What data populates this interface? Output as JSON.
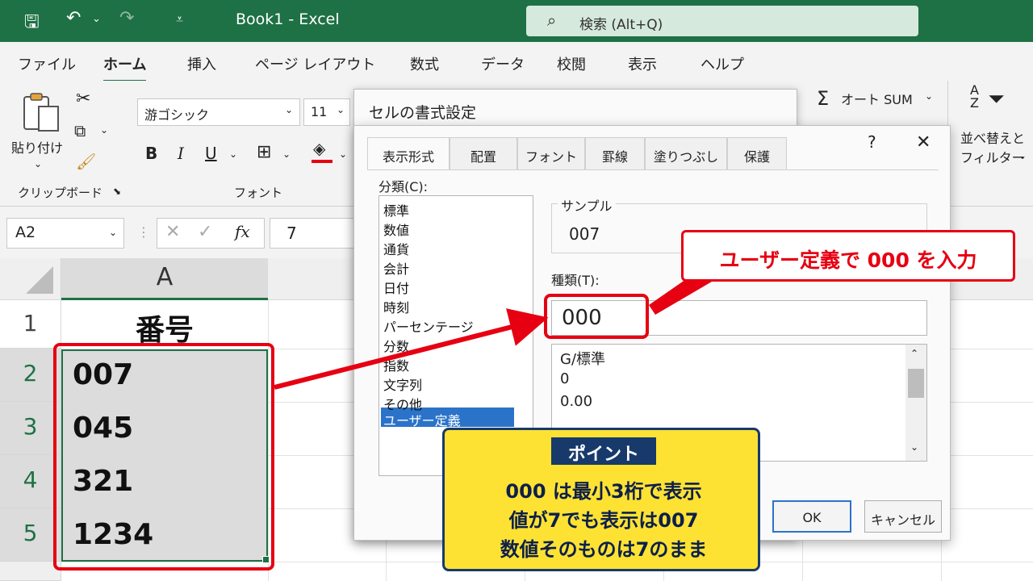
{
  "window": {
    "title": "Book1  -  Excel",
    "search": "検索 (Alt+Q)"
  },
  "tabs": [
    "ファイル",
    "ホーム",
    "挿入",
    "ページ レイアウト",
    "数式",
    "データ",
    "校閲",
    "表示",
    "ヘルプ"
  ],
  "ribbon": {
    "paste": "貼り付け",
    "clipboard": "クリップボード",
    "font_name": "游ゴシック",
    "font_size": "11",
    "font_group": "フォント",
    "bold": "B",
    "italic": "I",
    "underline": "U",
    "autosum": "オート SUM",
    "sort_filter_1": "並べ替えと",
    "sort_filter_2": "フィルター"
  },
  "formula_bar": {
    "name_box": "A2",
    "fx": "fx",
    "value": "7"
  },
  "sheet": {
    "column": "A",
    "rows": [
      {
        "num": "1",
        "value": "番号"
      },
      {
        "num": "2",
        "value": "007"
      },
      {
        "num": "3",
        "value": "045"
      },
      {
        "num": "4",
        "value": "321"
      },
      {
        "num": "5",
        "value": "1234"
      }
    ]
  },
  "dialog": {
    "title": "セルの書式設定",
    "help": "?",
    "close": "✕",
    "tabs": [
      "表示形式",
      "配置",
      "フォント",
      "罫線",
      "塗りつぶし",
      "保護"
    ],
    "category_label": "分類(C):",
    "categories": [
      "標準",
      "数値",
      "通貨",
      "会計",
      "日付",
      "時刻",
      "パーセンテージ",
      "分数",
      "指数",
      "文字列",
      "その他",
      "ユーザー定義"
    ],
    "sample_label": "サンプル",
    "sample_value": "007",
    "type_label": "種類(T):",
    "type_value": "000",
    "type_list": [
      "G/標準",
      "0",
      "0.00"
    ],
    "ok": "OK",
    "cancel": "キャンセル"
  },
  "annotations": {
    "callout": "ユーザー定義で 000 を入力",
    "point_title": "ポイント",
    "point_lines": [
      "000 は最小3桁で表示",
      "値が7でも表示は007",
      "数値そのものは7のまま"
    ]
  }
}
